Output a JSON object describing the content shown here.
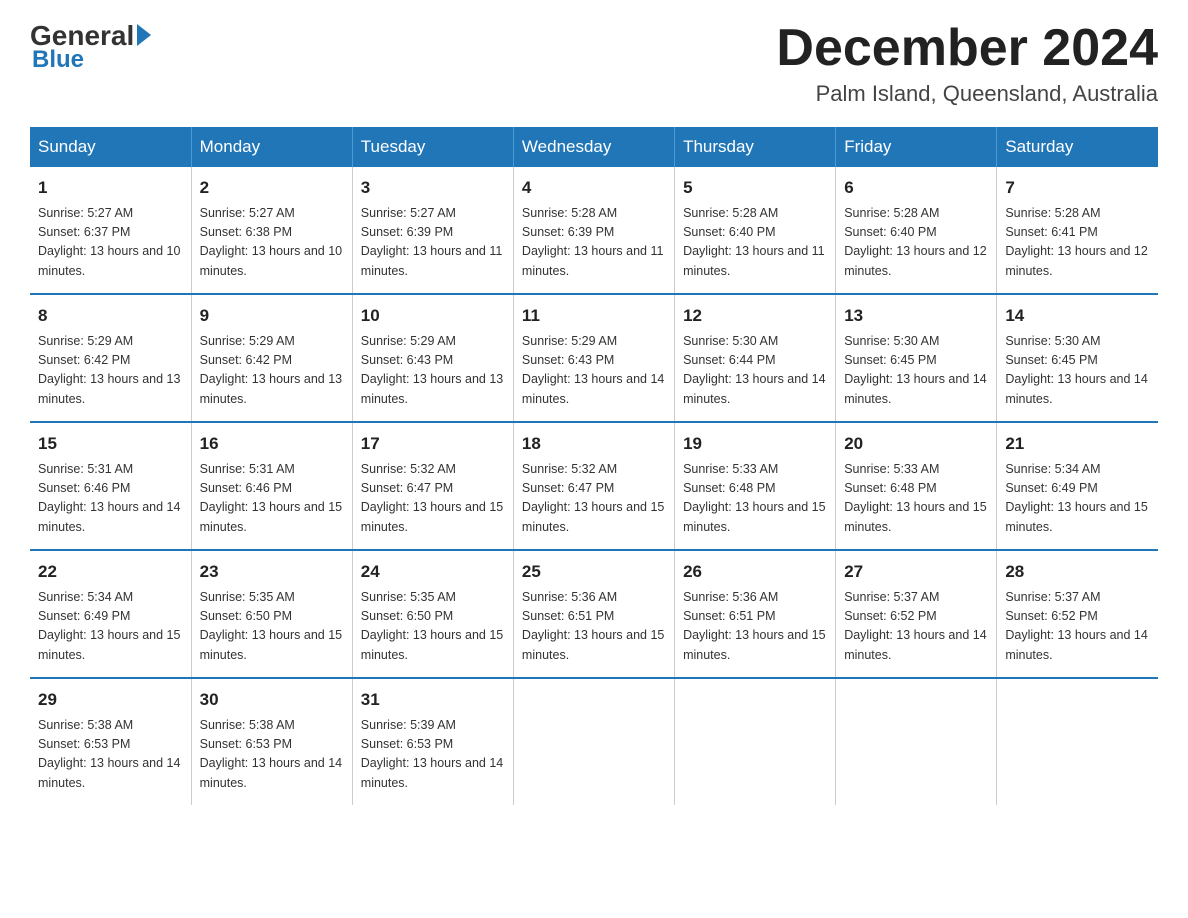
{
  "header": {
    "logo_general": "General",
    "logo_blue": "Blue",
    "month_title": "December 2024",
    "location": "Palm Island, Queensland, Australia"
  },
  "days_of_week": [
    "Sunday",
    "Monday",
    "Tuesday",
    "Wednesday",
    "Thursday",
    "Friday",
    "Saturday"
  ],
  "weeks": [
    [
      {
        "day": "1",
        "sunrise": "Sunrise: 5:27 AM",
        "sunset": "Sunset: 6:37 PM",
        "daylight": "Daylight: 13 hours and 10 minutes."
      },
      {
        "day": "2",
        "sunrise": "Sunrise: 5:27 AM",
        "sunset": "Sunset: 6:38 PM",
        "daylight": "Daylight: 13 hours and 10 minutes."
      },
      {
        "day": "3",
        "sunrise": "Sunrise: 5:27 AM",
        "sunset": "Sunset: 6:39 PM",
        "daylight": "Daylight: 13 hours and 11 minutes."
      },
      {
        "day": "4",
        "sunrise": "Sunrise: 5:28 AM",
        "sunset": "Sunset: 6:39 PM",
        "daylight": "Daylight: 13 hours and 11 minutes."
      },
      {
        "day": "5",
        "sunrise": "Sunrise: 5:28 AM",
        "sunset": "Sunset: 6:40 PM",
        "daylight": "Daylight: 13 hours and 11 minutes."
      },
      {
        "day": "6",
        "sunrise": "Sunrise: 5:28 AM",
        "sunset": "Sunset: 6:40 PM",
        "daylight": "Daylight: 13 hours and 12 minutes."
      },
      {
        "day": "7",
        "sunrise": "Sunrise: 5:28 AM",
        "sunset": "Sunset: 6:41 PM",
        "daylight": "Daylight: 13 hours and 12 minutes."
      }
    ],
    [
      {
        "day": "8",
        "sunrise": "Sunrise: 5:29 AM",
        "sunset": "Sunset: 6:42 PM",
        "daylight": "Daylight: 13 hours and 13 minutes."
      },
      {
        "day": "9",
        "sunrise": "Sunrise: 5:29 AM",
        "sunset": "Sunset: 6:42 PM",
        "daylight": "Daylight: 13 hours and 13 minutes."
      },
      {
        "day": "10",
        "sunrise": "Sunrise: 5:29 AM",
        "sunset": "Sunset: 6:43 PM",
        "daylight": "Daylight: 13 hours and 13 minutes."
      },
      {
        "day": "11",
        "sunrise": "Sunrise: 5:29 AM",
        "sunset": "Sunset: 6:43 PM",
        "daylight": "Daylight: 13 hours and 14 minutes."
      },
      {
        "day": "12",
        "sunrise": "Sunrise: 5:30 AM",
        "sunset": "Sunset: 6:44 PM",
        "daylight": "Daylight: 13 hours and 14 minutes."
      },
      {
        "day": "13",
        "sunrise": "Sunrise: 5:30 AM",
        "sunset": "Sunset: 6:45 PM",
        "daylight": "Daylight: 13 hours and 14 minutes."
      },
      {
        "day": "14",
        "sunrise": "Sunrise: 5:30 AM",
        "sunset": "Sunset: 6:45 PM",
        "daylight": "Daylight: 13 hours and 14 minutes."
      }
    ],
    [
      {
        "day": "15",
        "sunrise": "Sunrise: 5:31 AM",
        "sunset": "Sunset: 6:46 PM",
        "daylight": "Daylight: 13 hours and 14 minutes."
      },
      {
        "day": "16",
        "sunrise": "Sunrise: 5:31 AM",
        "sunset": "Sunset: 6:46 PM",
        "daylight": "Daylight: 13 hours and 15 minutes."
      },
      {
        "day": "17",
        "sunrise": "Sunrise: 5:32 AM",
        "sunset": "Sunset: 6:47 PM",
        "daylight": "Daylight: 13 hours and 15 minutes."
      },
      {
        "day": "18",
        "sunrise": "Sunrise: 5:32 AM",
        "sunset": "Sunset: 6:47 PM",
        "daylight": "Daylight: 13 hours and 15 minutes."
      },
      {
        "day": "19",
        "sunrise": "Sunrise: 5:33 AM",
        "sunset": "Sunset: 6:48 PM",
        "daylight": "Daylight: 13 hours and 15 minutes."
      },
      {
        "day": "20",
        "sunrise": "Sunrise: 5:33 AM",
        "sunset": "Sunset: 6:48 PM",
        "daylight": "Daylight: 13 hours and 15 minutes."
      },
      {
        "day": "21",
        "sunrise": "Sunrise: 5:34 AM",
        "sunset": "Sunset: 6:49 PM",
        "daylight": "Daylight: 13 hours and 15 minutes."
      }
    ],
    [
      {
        "day": "22",
        "sunrise": "Sunrise: 5:34 AM",
        "sunset": "Sunset: 6:49 PM",
        "daylight": "Daylight: 13 hours and 15 minutes."
      },
      {
        "day": "23",
        "sunrise": "Sunrise: 5:35 AM",
        "sunset": "Sunset: 6:50 PM",
        "daylight": "Daylight: 13 hours and 15 minutes."
      },
      {
        "day": "24",
        "sunrise": "Sunrise: 5:35 AM",
        "sunset": "Sunset: 6:50 PM",
        "daylight": "Daylight: 13 hours and 15 minutes."
      },
      {
        "day": "25",
        "sunrise": "Sunrise: 5:36 AM",
        "sunset": "Sunset: 6:51 PM",
        "daylight": "Daylight: 13 hours and 15 minutes."
      },
      {
        "day": "26",
        "sunrise": "Sunrise: 5:36 AM",
        "sunset": "Sunset: 6:51 PM",
        "daylight": "Daylight: 13 hours and 15 minutes."
      },
      {
        "day": "27",
        "sunrise": "Sunrise: 5:37 AM",
        "sunset": "Sunset: 6:52 PM",
        "daylight": "Daylight: 13 hours and 14 minutes."
      },
      {
        "day": "28",
        "sunrise": "Sunrise: 5:37 AM",
        "sunset": "Sunset: 6:52 PM",
        "daylight": "Daylight: 13 hours and 14 minutes."
      }
    ],
    [
      {
        "day": "29",
        "sunrise": "Sunrise: 5:38 AM",
        "sunset": "Sunset: 6:53 PM",
        "daylight": "Daylight: 13 hours and 14 minutes."
      },
      {
        "day": "30",
        "sunrise": "Sunrise: 5:38 AM",
        "sunset": "Sunset: 6:53 PM",
        "daylight": "Daylight: 13 hours and 14 minutes."
      },
      {
        "day": "31",
        "sunrise": "Sunrise: 5:39 AM",
        "sunset": "Sunset: 6:53 PM",
        "daylight": "Daylight: 13 hours and 14 minutes."
      },
      null,
      null,
      null,
      null
    ]
  ]
}
